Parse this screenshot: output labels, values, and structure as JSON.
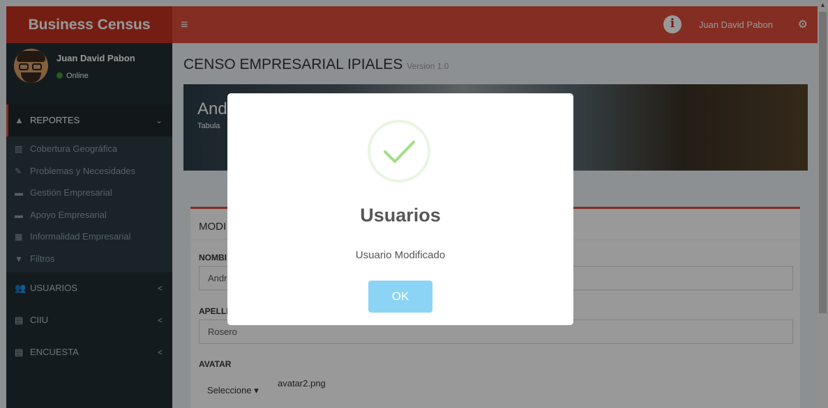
{
  "header": {
    "logo": "Business Census",
    "toggle_icon": "≡",
    "user": "Juan David Pabon",
    "gear_icon": "⚙"
  },
  "sidebar": {
    "user_name": "Juan David Pabon",
    "status": "Online",
    "status_color": "#3c9b3c",
    "menu": [
      {
        "label": "REPORTES",
        "icon": "▲",
        "chevron": "⌄"
      },
      {
        "label": "USUARIOS",
        "icon": "👥",
        "chevron": "<"
      },
      {
        "label": "CIIU",
        "icon": "▤",
        "chevron": "<"
      },
      {
        "label": "ENCUESTA",
        "icon": "▤",
        "chevron": "<"
      }
    ],
    "submenu": [
      {
        "label": "Cobertura Geográfica",
        "icon": "▥"
      },
      {
        "label": "Problemas y Necesidades",
        "icon": "✎"
      },
      {
        "label": "Gestión Empresarial",
        "icon": "▬"
      },
      {
        "label": "Apoyo Empresarial",
        "icon": "▬"
      },
      {
        "label": "Informalidad Empresarial",
        "icon": "▦"
      },
      {
        "label": "Filtros",
        "icon": "▼"
      }
    ]
  },
  "page": {
    "title": "CENSO EMPRESARIAL IPIALES",
    "version": "Version 1.0"
  },
  "banner": {
    "title": "And",
    "subtitle": "Tabula"
  },
  "form": {
    "box_title": "MODI",
    "name_label": "NOMBI",
    "name_value": "Andr",
    "lastname_label": "APELLI",
    "lastname_value": "Rosero",
    "avatar_label": "AVATAR",
    "select_label": "Seleccione",
    "file_name": "avatar2.png"
  },
  "modal": {
    "title": "Usuarios",
    "text": "Usuario Modificado",
    "ok_label": "OK"
  },
  "colors": {
    "topbar": "#dd4b39",
    "logo_bg": "#c23321",
    "sidebar": "#222d32",
    "ok_button": "#8cd4f5",
    "check": "#a5dc86"
  }
}
